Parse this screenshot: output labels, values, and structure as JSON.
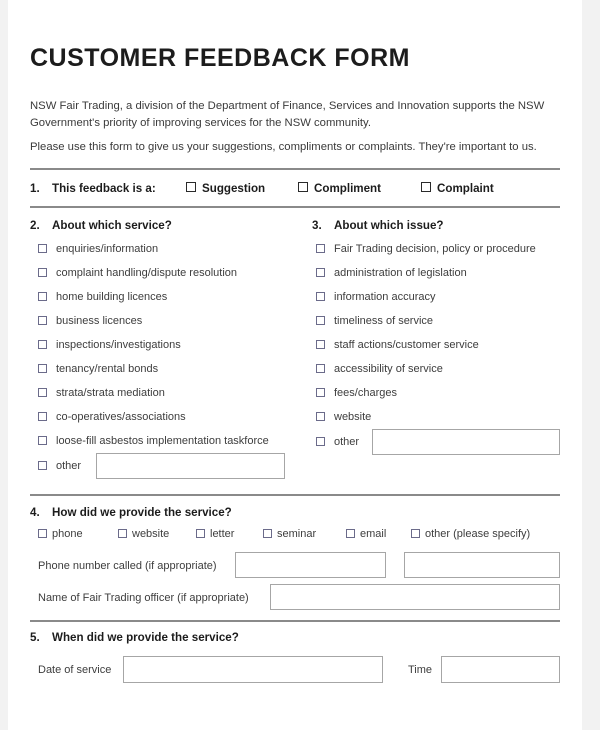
{
  "document": {
    "title": "CUSTOMER FEEDBACK FORM",
    "intro_paragraph_1": "NSW Fair Trading, a division of the Department of Finance, Services and Innovation supports the NSW Government's priority of improving services for the NSW community.",
    "intro_paragraph_2": "Please use this form to give us your suggestions, compliments or complaints. They're important to us."
  },
  "question1": {
    "number": "1.",
    "title": "This feedback is a:",
    "options": [
      {
        "label": "Suggestion"
      },
      {
        "label": "Compliment"
      },
      {
        "label": "Complaint"
      }
    ]
  },
  "question2": {
    "number": "2.",
    "title": "About which service?",
    "options": [
      {
        "label": "enquiries/information"
      },
      {
        "label": "complaint handling/dispute resolution"
      },
      {
        "label": "home building licences"
      },
      {
        "label": "business licences"
      },
      {
        "label": "inspections/investigations"
      },
      {
        "label": "tenancy/rental bonds"
      },
      {
        "label": "strata/strata mediation"
      },
      {
        "label": "co-operatives/associations"
      },
      {
        "label": "loose-fill asbestos implementation taskforce"
      },
      {
        "label": "other"
      }
    ],
    "other_value": "",
    "other_placeholder": ""
  },
  "question3": {
    "number": "3.",
    "title": "About which issue?",
    "options": [
      {
        "label": "Fair Trading decision, policy or procedure"
      },
      {
        "label": "administration of legislation"
      },
      {
        "label": "information accuracy"
      },
      {
        "label": "timeliness of service"
      },
      {
        "label": "staff actions/customer service"
      },
      {
        "label": "accessibility of service"
      },
      {
        "label": "fees/charges"
      },
      {
        "label": "website"
      },
      {
        "label": "other"
      }
    ],
    "other_value": "",
    "other_placeholder": ""
  },
  "question4": {
    "number": "4.",
    "title": "How did we provide the service?",
    "options": [
      {
        "label": "phone"
      },
      {
        "label": "website"
      },
      {
        "label": "letter"
      },
      {
        "label": "seminar"
      },
      {
        "label": "email"
      },
      {
        "label": "other (please specify)"
      }
    ],
    "phone_label": "Phone number called (if appropriate)",
    "phone_value": "",
    "phone_placeholder": "",
    "other_specify_value": "",
    "other_specify_placeholder": "",
    "officer_label": "Name of Fair Trading officer (if appropriate)",
    "officer_value": "",
    "officer_placeholder": ""
  },
  "question5": {
    "number": "5.",
    "title": "When did we provide the service?",
    "date_label": "Date of service",
    "date_value": "",
    "date_placeholder": "",
    "time_label": "Time",
    "time_value": "",
    "time_placeholder": ""
  },
  "colors": {
    "page_background": "#ffffff",
    "outer_background": "#f2f2f2",
    "rule": "#8a8a8a",
    "heading_text": "#1c1c1c",
    "body_text": "#3d3d3d",
    "checkbox_border": "#6b6b8a",
    "field_border": "#a6a6a6"
  }
}
